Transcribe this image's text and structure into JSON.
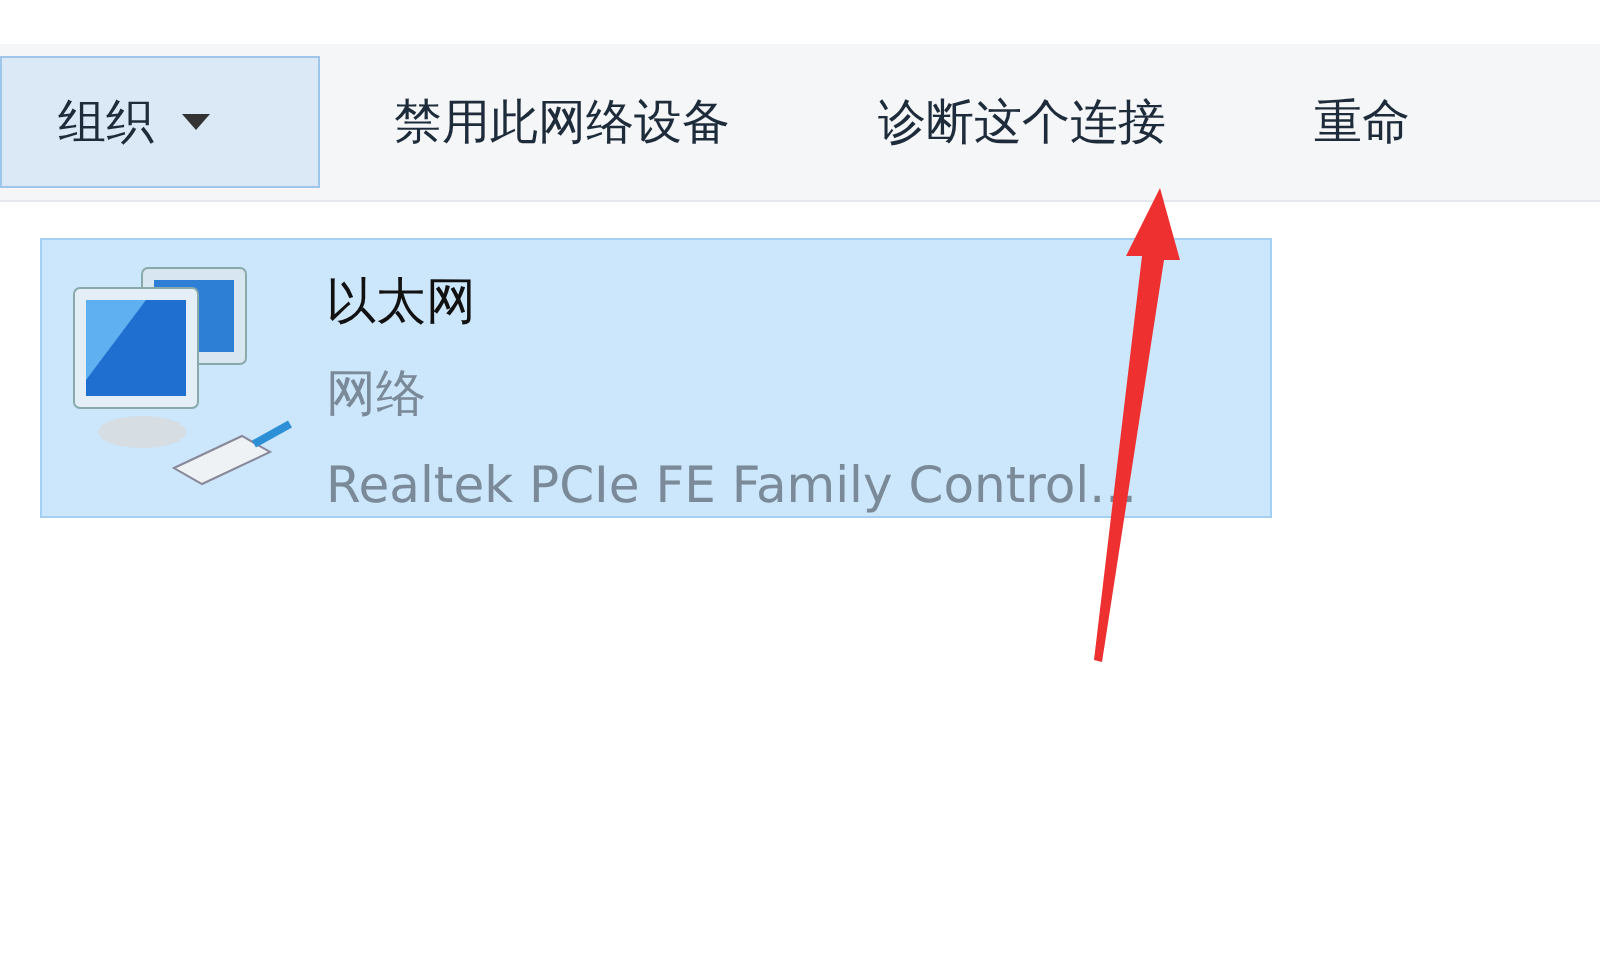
{
  "toolbar": {
    "items": [
      {
        "label": "组织",
        "kind": "dropdown",
        "highlighted": true
      },
      {
        "label": "禁用此网络设备",
        "kind": "button",
        "highlighted": false
      },
      {
        "label": "诊断这个连接",
        "kind": "button",
        "highlighted": false
      },
      {
        "label": "重命",
        "kind": "button",
        "highlighted": false
      }
    ]
  },
  "connections": [
    {
      "name": "以太网",
      "network": "网络",
      "adapter": "Realtek PCIe FE Family Control...",
      "selected": true
    }
  ],
  "annotation": {
    "kind": "arrow"
  }
}
